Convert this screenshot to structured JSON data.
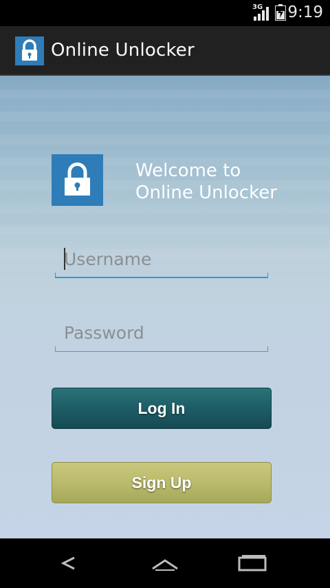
{
  "status_bar": {
    "network": "3G",
    "time": "9:19",
    "icons": [
      "signal-icon",
      "battery-icon"
    ]
  },
  "action_bar": {
    "title": "Online Unlocker",
    "icon": "lock-icon",
    "icon_color": "#2e7db8"
  },
  "welcome": {
    "line1": "Welcome to",
    "line2": "Online Unlocker",
    "logo_icon": "lock-icon"
  },
  "form": {
    "username": {
      "value": "",
      "placeholder": "Username",
      "focused": true
    },
    "password": {
      "value": "",
      "placeholder": "Password",
      "focused": false
    }
  },
  "buttons": {
    "login_label": "Log In",
    "signup_label": "Sign Up"
  },
  "nav_bar": {
    "buttons": [
      "back-icon",
      "home-icon",
      "recent-apps-icon"
    ]
  },
  "colors": {
    "accent": "#2e7db8",
    "focus_line": "#2b98d3",
    "login_button": "#1d5d66",
    "signup_button": "#b8b96a"
  }
}
